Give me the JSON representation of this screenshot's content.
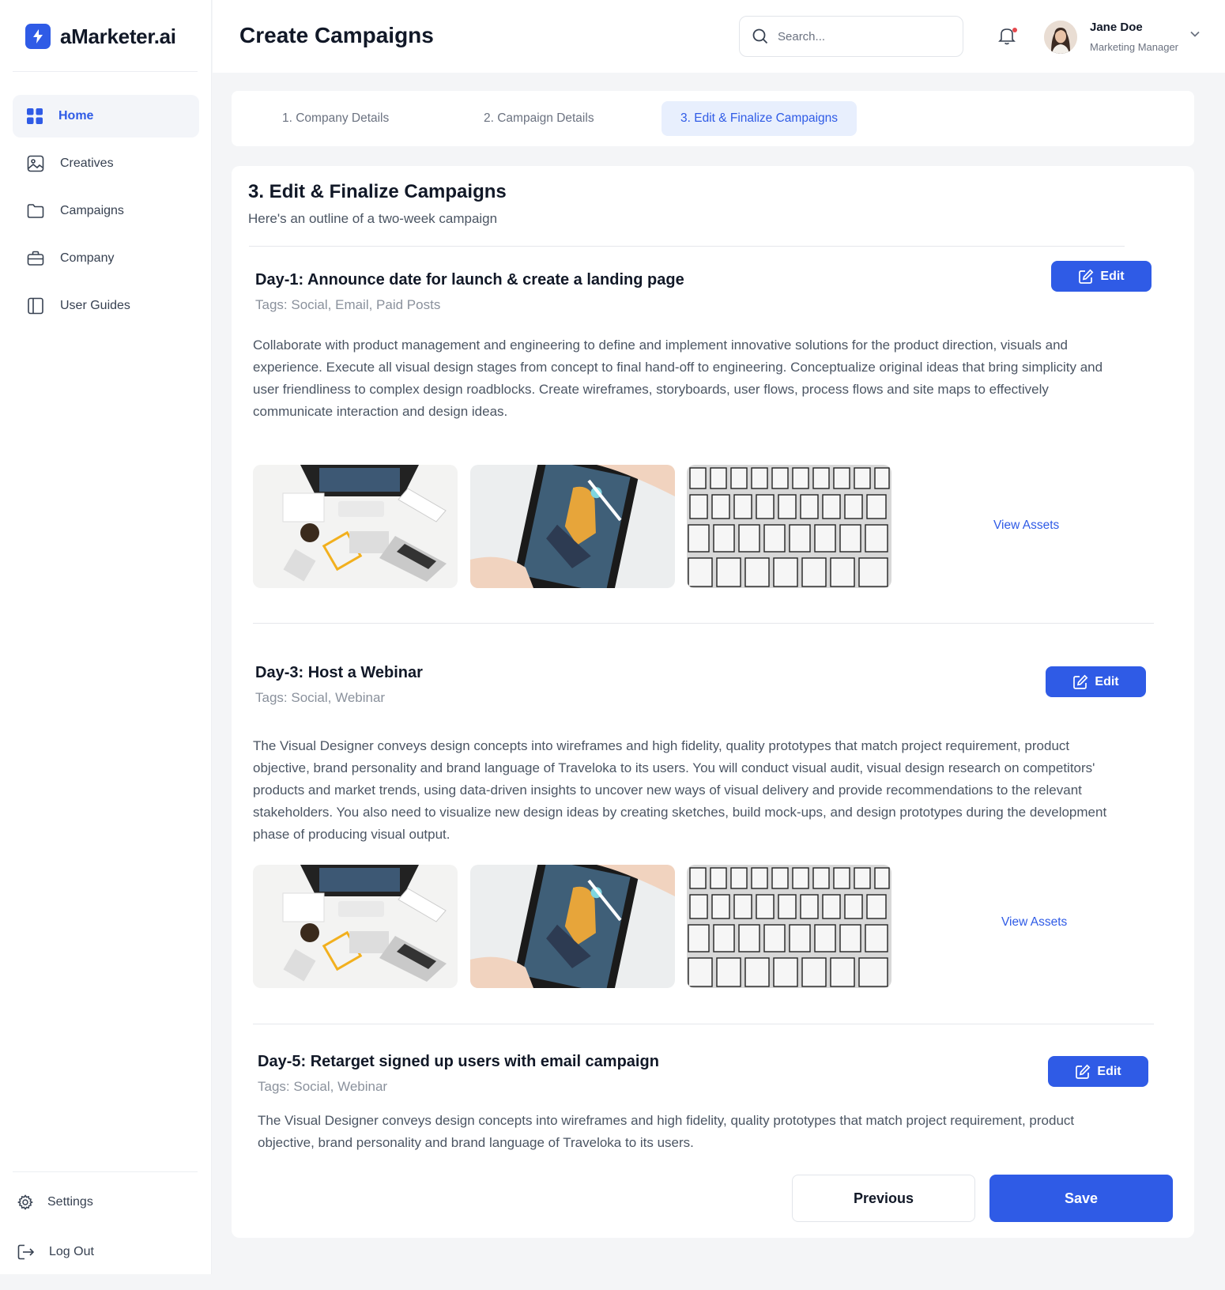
{
  "app": {
    "name": "aMarketer.ai",
    "logo_icon": "bolt-icon",
    "accent_color": "#2f5be6"
  },
  "sidebar": {
    "items": [
      {
        "label": "Home",
        "icon": "grid-icon",
        "active": true
      },
      {
        "label": "Creatives",
        "icon": "image-icon",
        "active": false
      },
      {
        "label": "Campaigns",
        "icon": "folder-icon",
        "active": false
      },
      {
        "label": "Company",
        "icon": "briefcase-icon",
        "active": false
      },
      {
        "label": "User Guides",
        "icon": "book-icon",
        "active": false
      }
    ],
    "settings_label": "Settings",
    "logout_label": "Log Out"
  },
  "header": {
    "title": "Create Campaigns",
    "search_placeholder": "Search...",
    "user": {
      "name": "Jane Doe",
      "role": "Marketing Manager"
    }
  },
  "stepper": {
    "steps": [
      {
        "label": "1. Company Details",
        "active": false
      },
      {
        "label": "2. Campaign Details",
        "active": false
      },
      {
        "label": "3. Edit & Finalize Campaigns",
        "active": true
      }
    ]
  },
  "main": {
    "title": "3. Edit & Finalize Campaigns",
    "subtitle": "Here's an outline of a two-week campaign",
    "edit_label": "Edit",
    "view_assets_label": "View Assets",
    "days": [
      {
        "title": "Day-1: Announce date for launch & create a landing page",
        "tags": "Tags: Social, Email, Paid Posts",
        "description": "Collaborate with product management and engineering to define and implement innovative solutions for the product direction, visuals and experience. Execute all visual design stages from concept to final hand-off to engineering. Conceptualize original ideas that bring simplicity and user friendliness to complex design roadblocks. Create wireframes, storyboards, user flows, process flows and site maps to effectively communicate interaction and design ideas."
      },
      {
        "title": "Day-3: Host a Webinar",
        "tags": "Tags: Social, Webinar",
        "description": "The Visual Designer conveys design concepts into wireframes and high fidelity, quality prototypes that match project requirement, product objective, brand personality and brand language of Traveloka to its users. You will conduct visual audit, visual design research on competitors' products and market trends, using data-driven insights to uncover new ways of visual delivery and provide recommendations to the relevant stakeholders. You also need to visualize new design ideas by creating sketches, build mock-ups, and design prototypes during the development phase of producing visual output."
      },
      {
        "title": "Day-5: Retarget signed up users with email campaign",
        "tags": "Tags: Social, Webinar",
        "description": "The Visual Designer conveys design concepts into wireframes and high fidelity, quality prototypes that match project requirement, product objective, brand personality and brand language of Traveloka to its users."
      }
    ]
  },
  "actions": {
    "previous_label": "Previous",
    "save_label": "Save"
  }
}
